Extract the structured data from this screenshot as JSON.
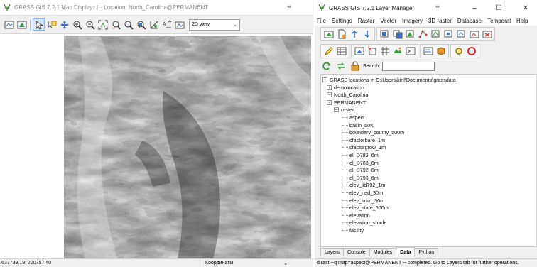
{
  "map_display": {
    "title": "GRASS GIS 7.2.1 Map Display: 1 - Location: North_Carolina@PERMANENT",
    "view_mode": "2D view",
    "toolbar_icons": [
      "display-map-icon",
      "pointer-icon",
      "query-icon",
      "pan-icon",
      "zoom-in-icon",
      "zoom-out-icon",
      "zoom-extent-icon",
      "zoom-back-icon",
      "zoom-menu-icon",
      "zoom-region-icon",
      "analyze-icon",
      "decoration-icon",
      "save-image-icon"
    ],
    "coordinates": "637739.19; 220757.40",
    "status_combo": "Координаты"
  },
  "layer_manager": {
    "title": "GRASS GIS 7.2.1 Layer Manager",
    "menu": [
      "File",
      "Settings",
      "Raster",
      "Vector",
      "Imagery",
      "3D raster",
      "Database",
      "Temporal",
      "Help"
    ],
    "search_label": "Search:",
    "search_value": "",
    "tree": {
      "root": "GRASS locations in C:\\Users\\kiril\\Documents\\grassdata",
      "locations": [
        "demolocation",
        "North_Carolina"
      ],
      "mapset": "PERMANENT",
      "category": "raster",
      "rasters": [
        "aspect",
        "basin_50K",
        "boundary_county_500m",
        "cfactorbare_1m",
        "cfactorgrow_1m",
        "el_D782_6m",
        "el_D783_6m",
        "el_D792_6m",
        "el_D793_6m",
        "elev_lid792_1m",
        "elev_ned_30m",
        "elev_srtm_30m",
        "elev_state_500m",
        "elevation",
        "elevation_shade",
        "facility"
      ]
    },
    "tabs": [
      "Layers",
      "Console",
      "Modules",
      "Data",
      "Python"
    ],
    "active_tab": "Data",
    "status": "d.rast --q map=aspect@PERMANENT -- completed. Go to Layers tab for further operations."
  },
  "colors": {
    "window_bg": "#f0f0f0",
    "tab_active": "#ffffff",
    "icon_green": "#3f9a3f",
    "icon_orange": "#e8962a",
    "icon_blue": "#3a6fc2",
    "icon_red": "#d23a3a"
  }
}
